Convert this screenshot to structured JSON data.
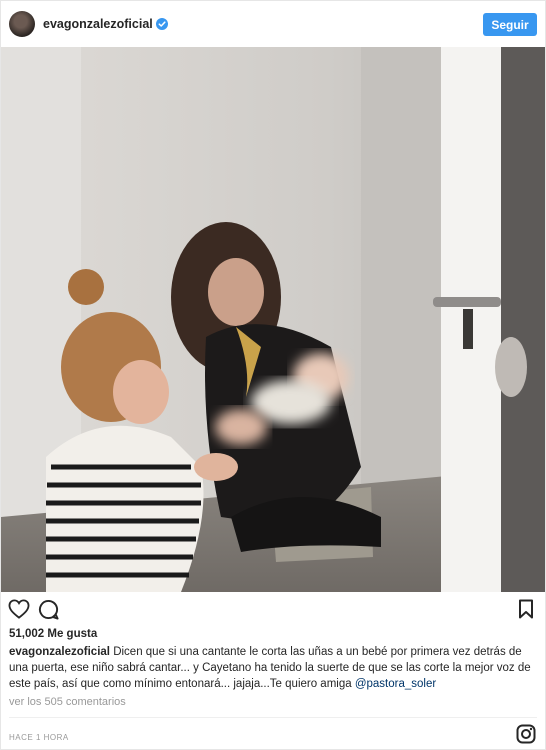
{
  "header": {
    "username": "evagonzalezoficial",
    "follow_label": "Seguir"
  },
  "post": {
    "likes": "51,002 Me gusta",
    "caption_user": "evagonzalezoficial",
    "caption_text": "Dicen que si una cantante le corta las uñas a un bebé por primera vez detrás de una puerta, ese niño sabrá cantar... y Cayetano ha tenido la suerte de que se las corte la mejor voz de este país, así que como mínimo entonará... jajaja...Te quiero amiga ",
    "caption_mention": "@pastora_soler",
    "view_comments": "ver los 505 comentarios",
    "time": "HACE 1 HORA"
  },
  "icons": {
    "like": "heart-outline-icon",
    "comment": "comment-bubble-icon",
    "save": "bookmark-icon",
    "verified": "verified-badge-icon",
    "logo": "instagram-logo-icon"
  },
  "colors": {
    "follow_button": "#3897f0",
    "verified_badge": "#3897f0",
    "text": "#262626",
    "muted": "#999999",
    "mention": "#003569"
  }
}
